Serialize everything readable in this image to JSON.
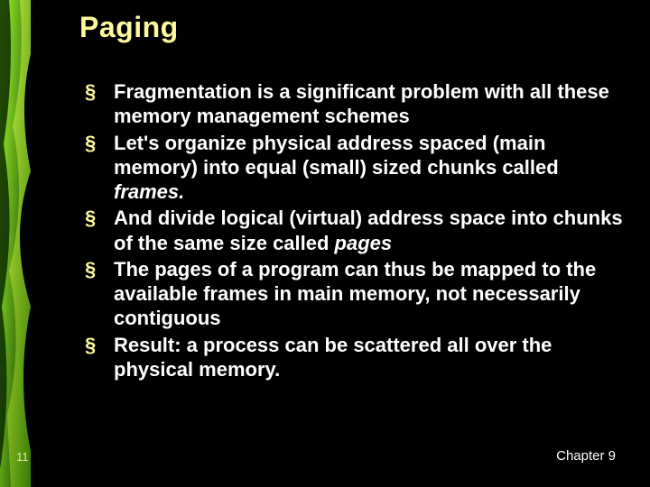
{
  "slide": {
    "title": "Paging",
    "bullets": [
      {
        "pre": "Fragmentation is a significant problem with all these memory management schemes",
        "em": "",
        "post": ""
      },
      {
        "pre": "Let's organize physical address spaced (main memory) into equal (small) sized chunks called ",
        "em": "frames.",
        "post": ""
      },
      {
        "pre": "And divide logical (virtual) address space into chunks of the same size called ",
        "em": "pages",
        "post": ""
      },
      {
        "pre": "The pages of a program can thus be mapped to the available frames in main memory, not necessarily contiguous",
        "em": "",
        "post": ""
      },
      {
        "pre": "Result: a process can be scattered all over the physical memory.",
        "em": "",
        "post": ""
      }
    ],
    "page_number": "11",
    "chapter": "Chapter 9"
  },
  "colors": {
    "accent_yellow": "#fefa9c",
    "accent_green_light": "#7fff00",
    "accent_green_dark": "#006400",
    "background": "#000000",
    "text": "#ffffff"
  }
}
